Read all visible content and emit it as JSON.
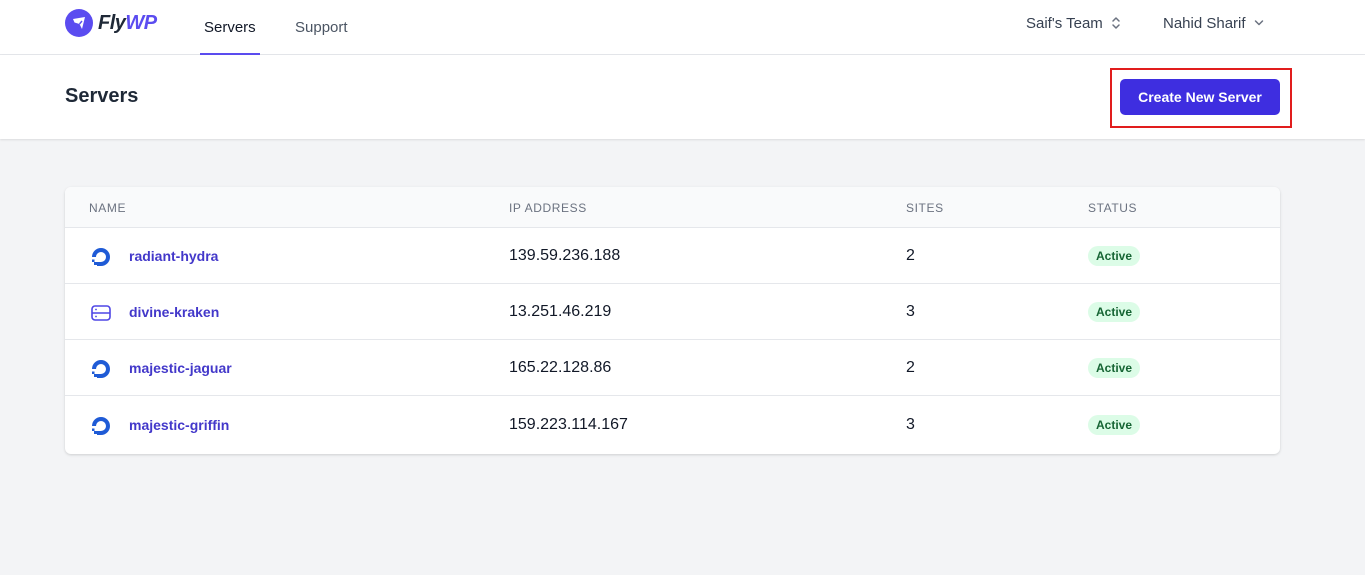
{
  "brand": {
    "name_prefix": "Fly",
    "name_suffix": "WP",
    "accent_color": "#5b4cf0"
  },
  "nav": {
    "tabs": [
      {
        "label": "Servers",
        "active": true
      },
      {
        "label": "Support",
        "active": false
      }
    ],
    "team_selector": {
      "label": "Saif's Team",
      "icon": "chevron-up-down-icon"
    },
    "user_menu": {
      "label": "Nahid Sharif",
      "icon": "chevron-down-icon"
    }
  },
  "page": {
    "title": "Servers",
    "create_button_label": "Create New Server",
    "create_button_color": "#3e2ee0",
    "highlight_color": "#e11d1d"
  },
  "table": {
    "columns": [
      "NAME",
      "IP ADDRESS",
      "SITES",
      "STATUS"
    ],
    "rows": [
      {
        "name": "radiant-hydra",
        "provider_icon": "digitalocean-icon",
        "ip": "139.59.236.188",
        "sites": "2",
        "status": "Active"
      },
      {
        "name": "divine-kraken",
        "provider_icon": "server-icon",
        "ip": "13.251.46.219",
        "sites": "3",
        "status": "Active"
      },
      {
        "name": "majestic-jaguar",
        "provider_icon": "digitalocean-icon",
        "ip": "165.22.128.86",
        "sites": "2",
        "status": "Active"
      },
      {
        "name": "majestic-griffin",
        "provider_icon": "digitalocean-icon",
        "ip": "159.223.114.167",
        "sites": "3",
        "status": "Active"
      }
    ],
    "status_color": "#166534",
    "link_color": "#4338ca"
  }
}
